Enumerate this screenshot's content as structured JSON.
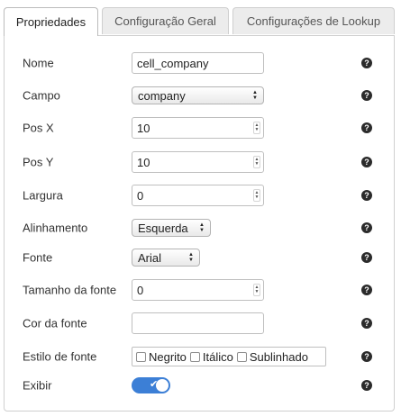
{
  "tabs": [
    {
      "label": "Propriedades",
      "active": true
    },
    {
      "label": "Configuração Geral",
      "active": false
    },
    {
      "label": "Configurações de Lookup",
      "active": false
    }
  ],
  "help_glyph": "?",
  "fields": {
    "nome": {
      "label": "Nome",
      "value": "cell_company"
    },
    "campo": {
      "label": "Campo",
      "value": "company"
    },
    "pos_x": {
      "label": "Pos X",
      "value": "10"
    },
    "pos_y": {
      "label": "Pos Y",
      "value": "10"
    },
    "largura": {
      "label": "Largura",
      "value": "0"
    },
    "alinhamento": {
      "label": "Alinhamento",
      "value": "Esquerda"
    },
    "fonte": {
      "label": "Fonte",
      "value": "Arial"
    },
    "tamanho": {
      "label": "Tamanho da fonte",
      "value": "0"
    },
    "cor": {
      "label": "Cor da fonte",
      "value": ""
    },
    "estilo": {
      "label": "Estilo de fonte",
      "options": [
        {
          "label": "Negrito",
          "checked": false
        },
        {
          "label": "Itálico",
          "checked": false
        },
        {
          "label": "Sublinhado",
          "checked": false
        }
      ]
    },
    "exibir": {
      "label": "Exibir",
      "on": true
    }
  },
  "colors": {
    "toggle_on": "#3c7fd6",
    "help_icon": "#2b2b2b"
  },
  "icons": {
    "help": "question-circle-icon",
    "toggle_check": "check-icon",
    "select_arrows": "up-down-arrows-icon"
  }
}
